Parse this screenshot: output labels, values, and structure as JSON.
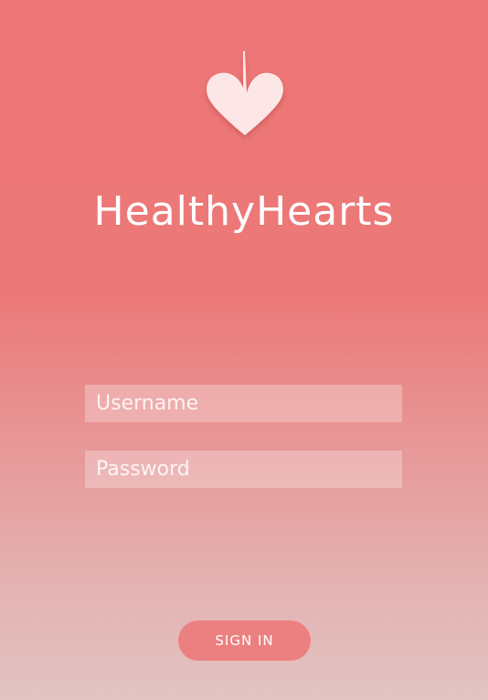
{
  "app": {
    "title": "HealthyHearts"
  },
  "logo": {
    "icon": "heart-with-heartbeat-icon",
    "color": "#fce6e6"
  },
  "form": {
    "username_placeholder": "Username",
    "username_value": "",
    "password_placeholder": "Password",
    "password_value": "",
    "sign_in_label": "SIGN IN"
  },
  "colors": {
    "background_top": "#ee7676",
    "background_bottom": "#e2c3c3",
    "button": "#ec8080",
    "text": "#ffffff"
  }
}
